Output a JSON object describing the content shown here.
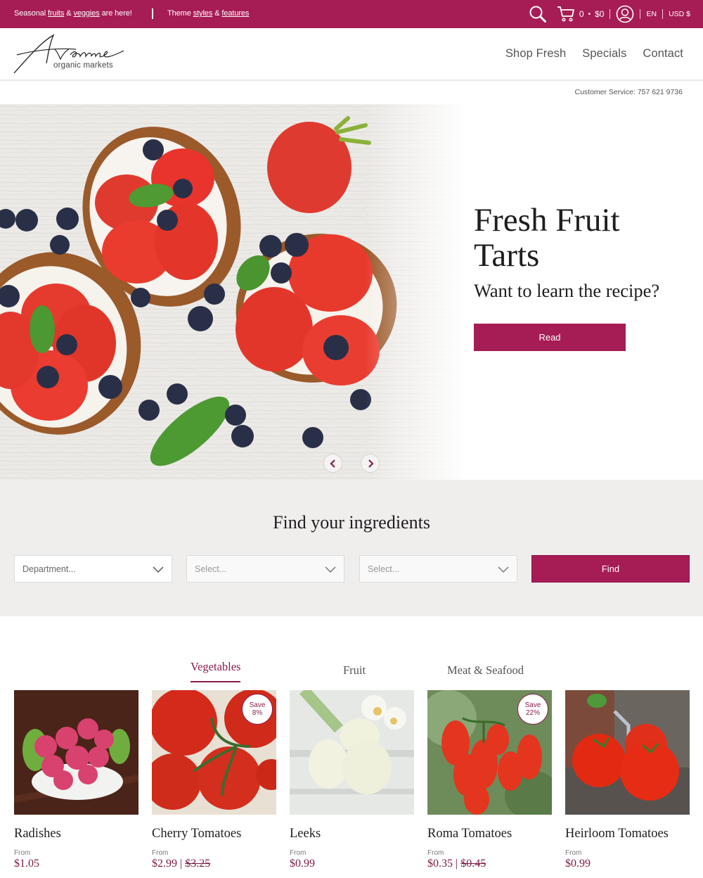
{
  "topbar": {
    "announcement1": {
      "prefix": "Seasonal ",
      "link1": "fruits",
      "mid": " & ",
      "link2": "veggies",
      "suffix": " are here!"
    },
    "announcement2": {
      "prefix": "Theme ",
      "link1": "styles",
      "mid": " & ",
      "link2": "features"
    },
    "cart_count": "0",
    "cart_dot": "•",
    "cart_total": "$0",
    "language": "EN",
    "currency": "USD $",
    "icons": [
      "search-icon",
      "cart-icon",
      "account-icon"
    ]
  },
  "header": {
    "logo_script": "Avenue",
    "logo_tagline": "organic markets",
    "nav": [
      "Shop Fresh",
      "Specials",
      "Contact"
    ]
  },
  "customer_service": "Customer Service: 757 621 9736",
  "hero": {
    "title": "Fresh Fruit Tarts",
    "subtitle": "Want to learn the recipe?",
    "button": "Read",
    "image_alt": "Toast tarts with cream cheese, strawberries, blueberries and basil"
  },
  "finder": {
    "heading": "Find your ingredients",
    "selects": [
      {
        "placeholder": "Department..."
      },
      {
        "placeholder": "Select..."
      },
      {
        "placeholder": "Select..."
      }
    ],
    "button": "Find"
  },
  "tabs": [
    {
      "label": "Vegetables",
      "active": true
    },
    {
      "label": "Fruit",
      "active": false
    },
    {
      "label": "Meat & Seafood",
      "active": false
    }
  ],
  "products": [
    {
      "name": "Radishes",
      "from": "From",
      "price": "$1.05",
      "compare": null,
      "badge": null
    },
    {
      "name": "Cherry Tomatoes",
      "from": "From",
      "price": "$2.99",
      "compare": "$3.25",
      "badge": {
        "line1": "Save",
        "line2": "8%"
      }
    },
    {
      "name": "Leeks",
      "from": "From",
      "price": "$0.99",
      "compare": null,
      "badge": null
    },
    {
      "name": "Roma Tomatoes",
      "from": "From",
      "price": "$0.35",
      "compare": "$0.45",
      "badge": {
        "line1": "Save",
        "line2": "22%"
      }
    },
    {
      "name": "Heirloom Tomatoes",
      "from": "From",
      "price": "$0.99",
      "compare": null,
      "badge": null
    }
  ],
  "price_separator": " | ",
  "colors": {
    "brand": "#a61c54",
    "price": "#7a1a44",
    "finder_bg": "#f0eded"
  }
}
